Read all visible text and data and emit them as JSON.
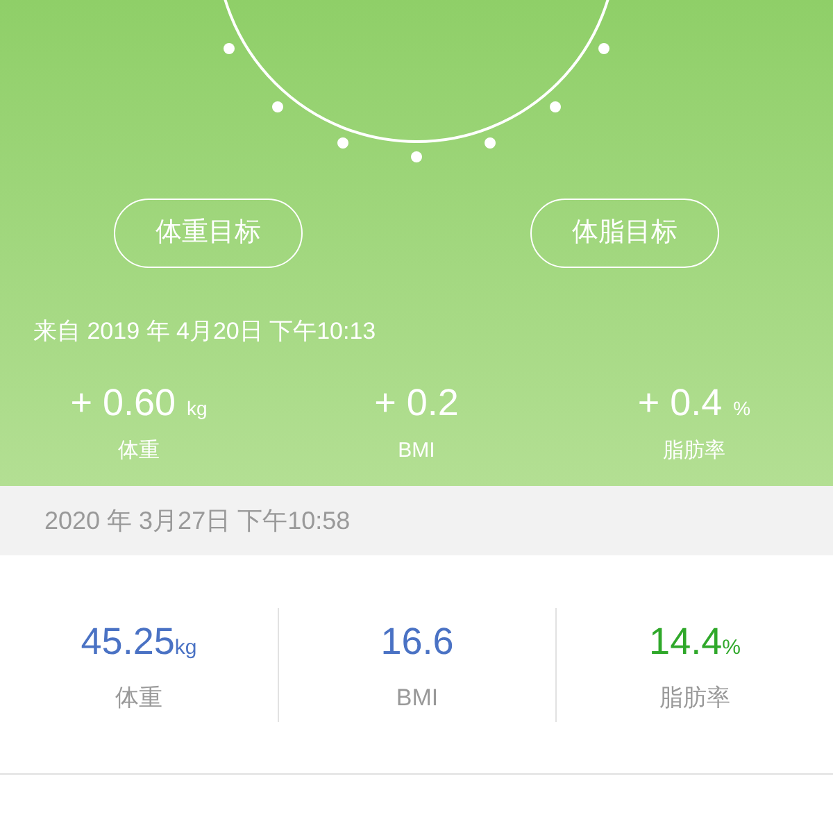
{
  "goal_buttons": [
    "体重目标",
    "体脂目标"
  ],
  "source": "来自 2019 年 4月20日 下午10:13",
  "changes": [
    {
      "value": "+ 0.60",
      "unit": "kg",
      "label": "体重"
    },
    {
      "value": "+ 0.2",
      "label": "BMI"
    },
    {
      "value": "+ 0.4",
      "unit": "%",
      "label": "脂肪率"
    }
  ],
  "record_date": "2020 年 3月27日 下午10:58",
  "metrics": [
    {
      "value": "45.25",
      "unit": "kg",
      "label": "体重",
      "color": "#4a72c4"
    },
    {
      "value": "16.6",
      "label": "BMI",
      "color": "#4a72c4"
    },
    {
      "value": "14.4",
      "unit": "%",
      "label": "脂肪率",
      "color": "#2fa82a"
    }
  ]
}
